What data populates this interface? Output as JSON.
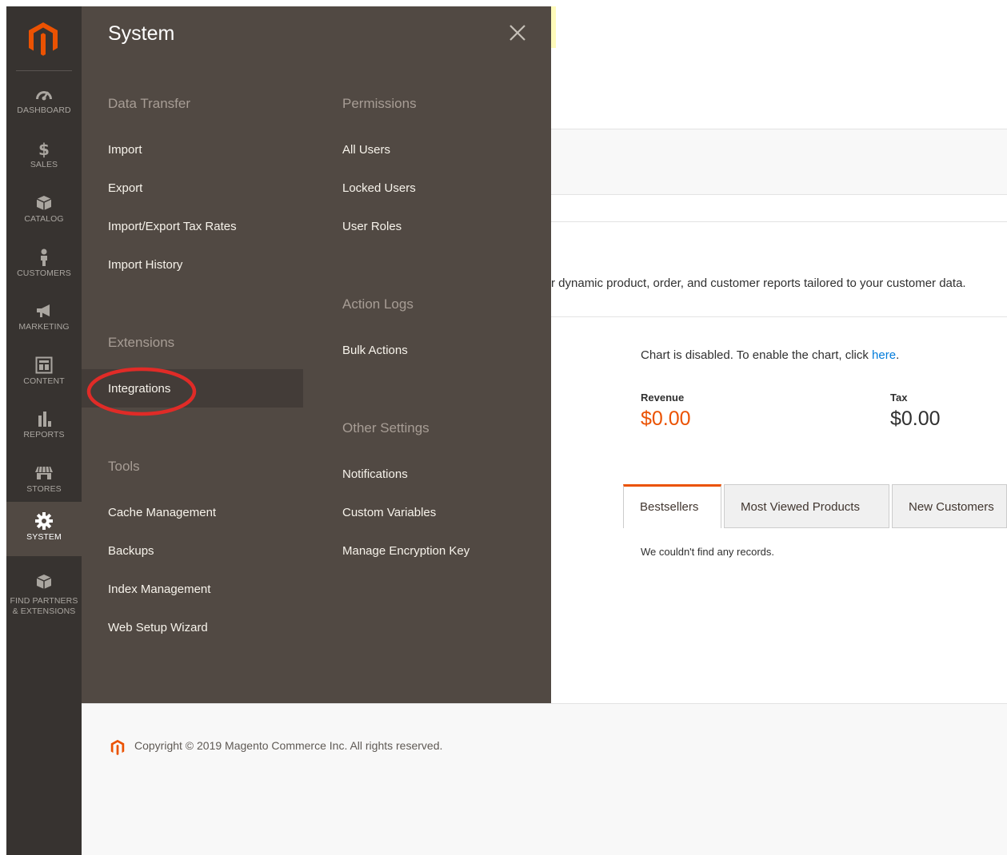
{
  "app": {
    "brand_color": "#eb5202",
    "logo_icon": "magento-logo-icon"
  },
  "sidebar": {
    "items": [
      {
        "label": "DASHBOARD",
        "icon": "dashboard-gauge-icon"
      },
      {
        "label": "SALES",
        "icon": "dollar-icon"
      },
      {
        "label": "CATALOG",
        "icon": "cube-icon"
      },
      {
        "label": "CUSTOMERS",
        "icon": "person-icon"
      },
      {
        "label": "MARKETING",
        "icon": "megaphone-icon"
      },
      {
        "label": "CONTENT",
        "icon": "layout-icon"
      },
      {
        "label": "REPORTS",
        "icon": "bar-chart-icon"
      },
      {
        "label": "STORES",
        "icon": "storefront-icon"
      },
      {
        "label": "SYSTEM",
        "icon": "gear-icon",
        "active": true
      },
      {
        "label_line1": "FIND PARTNERS",
        "label_line2": "& EXTENSIONS",
        "icon": "box-icon"
      }
    ]
  },
  "flyout": {
    "title": "System",
    "close_icon": "close-icon",
    "sections": {
      "data_transfer": {
        "title": "Data Transfer",
        "links": [
          "Import",
          "Export",
          "Import/Export Tax Rates",
          "Import History"
        ]
      },
      "extensions": {
        "title": "Extensions",
        "links": [
          "Integrations"
        ]
      },
      "tools": {
        "title": "Tools",
        "links": [
          "Cache Management",
          "Backups",
          "Index Management",
          "Web Setup Wizard"
        ]
      },
      "permissions": {
        "title": "Permissions",
        "links": [
          "All Users",
          "Locked Users",
          "User Roles"
        ]
      },
      "action_logs": {
        "title": "Action Logs",
        "links": [
          "Bulk Actions"
        ]
      },
      "other_settings": {
        "title": "Other Settings",
        "links": [
          "Notifications",
          "Custom Variables",
          "Manage Encryption Key"
        ]
      }
    },
    "highlight_color": "#e02b27"
  },
  "dashboard": {
    "intro_text": "r dynamic product, order, and customer reports tailored to your customer data.",
    "chart_message": "Chart is disabled. To enable the chart, click ",
    "chart_link": "here",
    "chart_message_end": ".",
    "revenue_label": "Revenue",
    "revenue_value": "$0.00",
    "tax_label": "Tax",
    "tax_value": "$0.00",
    "tabs": [
      "Bestsellers",
      "Most Viewed Products",
      "New Customers"
    ],
    "no_records": "We couldn't find any records."
  },
  "footer": {
    "copyright": "Copyright © 2019 Magento Commerce Inc. All rights reserved."
  }
}
